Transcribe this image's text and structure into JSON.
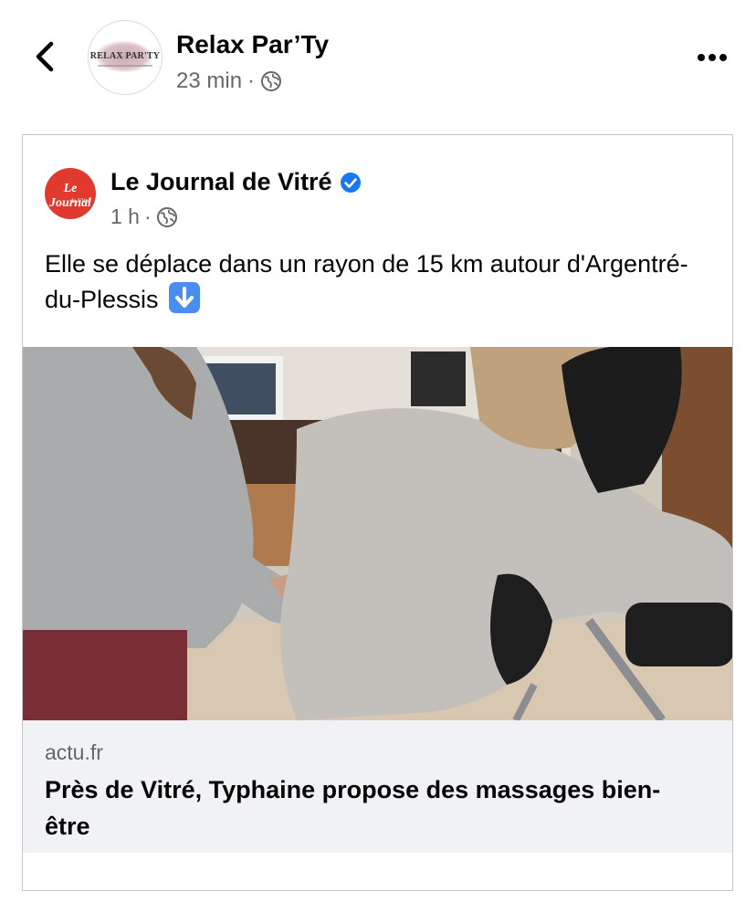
{
  "header": {
    "page_name": "Relax Par’Ty",
    "time": "23 min",
    "separator": "·",
    "avatar_text": "RELAX PAR'TY"
  },
  "shared_post": {
    "source_name": "Le Journal de Vitré",
    "source_avatar_text_1": "Le Journal",
    "source_avatar_text_2": "de Vitré",
    "time": "1 h",
    "separator": "·",
    "caption": "Elle se déplace dans un rayon de 15 km autour d'Argentré-du-Plessis",
    "caption_emoji": "down-arrow-emoji"
  },
  "link_preview": {
    "domain": "actu.fr",
    "title": "Près de Vitré, Typhaine propose des massages bien-être"
  },
  "icons": {
    "back": "chevron-left-icon",
    "more": "more-horizontal-icon",
    "audience": "globe-icon",
    "verified": "verified-badge-icon"
  },
  "colors": {
    "verified": "#1877f2",
    "secondary_text": "#65676b",
    "link_box_bg": "#f0f2f5",
    "source_avatar": "#e03a2e"
  }
}
